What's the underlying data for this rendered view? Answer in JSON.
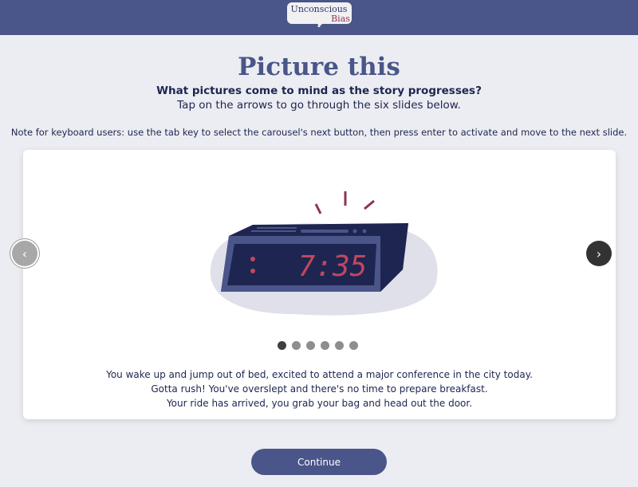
{
  "header": {
    "logo_line1": "Unconscious",
    "logo_line2": "Bias"
  },
  "main": {
    "title": "Picture this",
    "subtitle": "What pictures come to mind as the story progresses?",
    "instruction": "Tap on the arrows to go through the six slides below.",
    "note": "Note for keyboard users: use the tab key to select the carousel's next button, then press enter to activate and move to the next slide."
  },
  "carousel": {
    "clock_time": "7:35",
    "slide_count": 6,
    "active_slide": 1,
    "prev_icon": "chevron-left-icon",
    "next_icon": "chevron-right-icon",
    "prev_label": "‹",
    "next_label": "›",
    "lines": [
      "You wake up and jump out of bed, excited to attend a major conference in the city today.",
      "Gotta rush! You've overslept and there's no time to prepare breakfast.",
      "Your ride has arrived, you grab your bag and head out the door."
    ]
  },
  "continue_label": "Continue",
  "colors": {
    "brand": "#4a5589",
    "accent": "#8c3551",
    "background": "#ecedf2"
  }
}
